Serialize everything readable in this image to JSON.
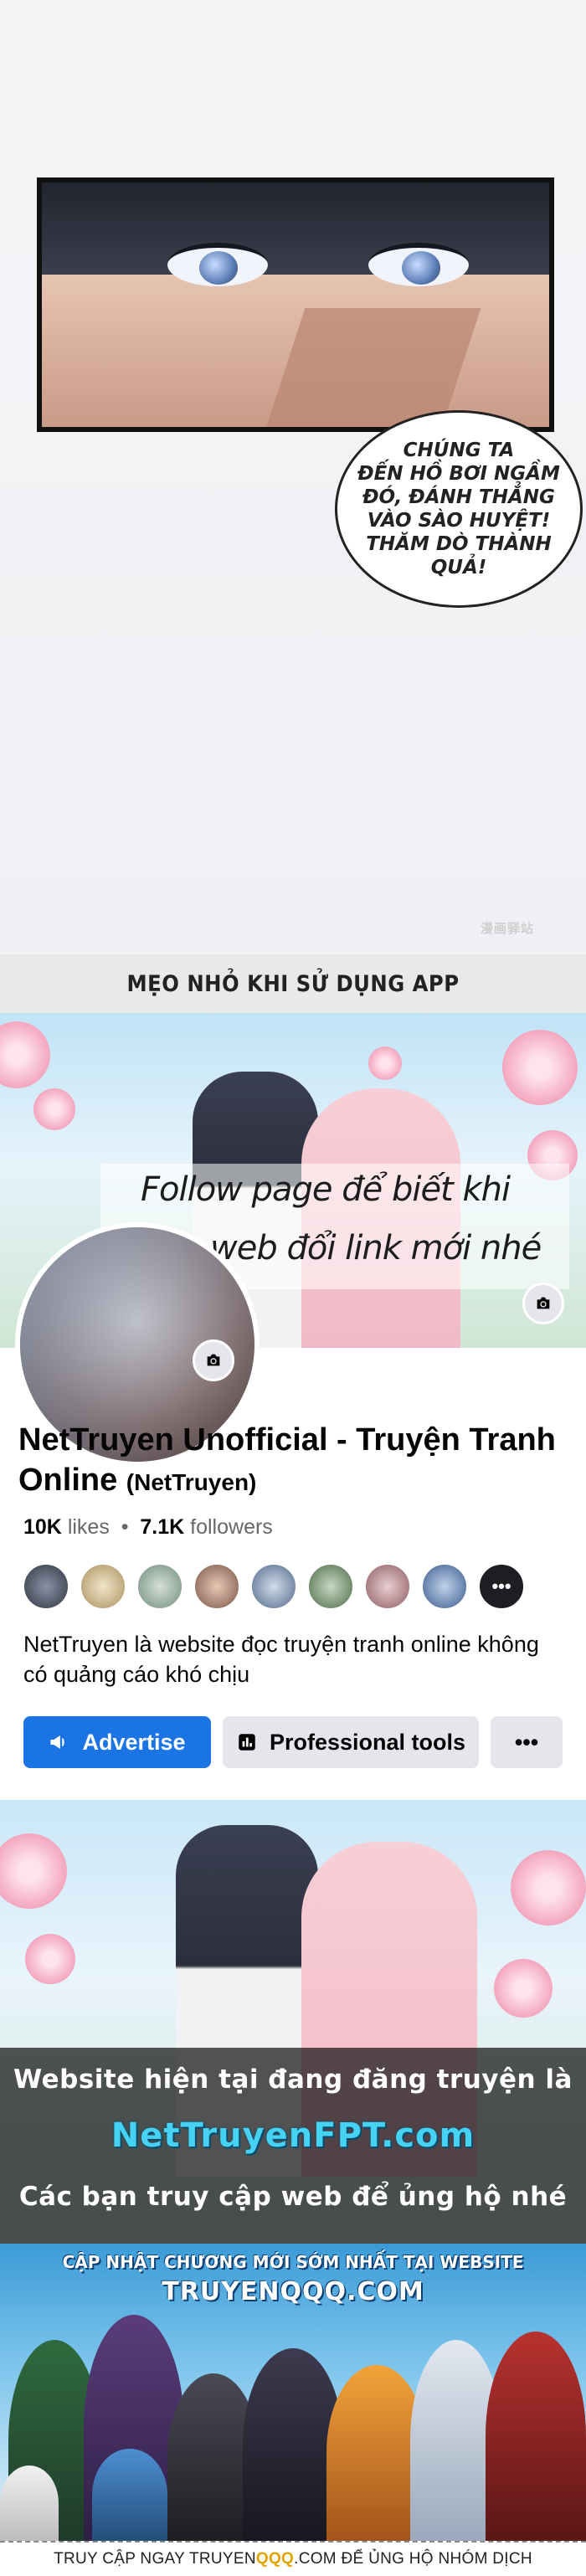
{
  "comic": {
    "speech": "CHÚNG TA\nĐẾN HỒ BƠI NGẦM\nĐÓ, ĐÁNH THẲNG\nVÀO SÀO HUYỆT!\nTHĂM DÒ THÀNH\nQUẢ!",
    "watermark": "漫画驿站"
  },
  "tips": {
    "title": "MẸO NHỎ KHI SỬ DỤNG APP"
  },
  "facebook": {
    "cover_text_1": "Follow page để biết khi",
    "cover_text_2": "nào web đổi link mới nhé",
    "page_name": "NetTruyen Unofficial - Truyện Tranh Online",
    "handle": "(NetTruyen)",
    "likes_count": "10K",
    "likes_label": "likes",
    "followers_count": "7.1K",
    "followers_label": "followers",
    "more_friends": "•••",
    "description": "NetTruyen là website đọc truyện tranh online không có quảng cáo khó chịu",
    "buttons": {
      "advertise": "Advertise",
      "professional": "Professional tools",
      "more": "•••"
    },
    "camera_icon": "camera-icon",
    "colors": {
      "primary": "#1b74e4",
      "secondary": "#e4e6eb"
    }
  },
  "site_banner": {
    "line1": "Website hiện tại đang đăng truyện là",
    "site": "NetTruyenFPT.com",
    "line2": "Các bạn truy cập web để ủng hộ nhé"
  },
  "ad": {
    "headline": "CẬP NHẬT CHƯƠNG MỚI SỚM NHẤT TẠI WEBSITE",
    "site": "TRUYENQQQ.COM",
    "footer_pre": "TRUY CẬP NGAY TRUYEN",
    "footer_hl": "QQQ",
    "footer_post": ".COM ĐỂ ỦNG HỘ NHÓM DỊCH"
  }
}
